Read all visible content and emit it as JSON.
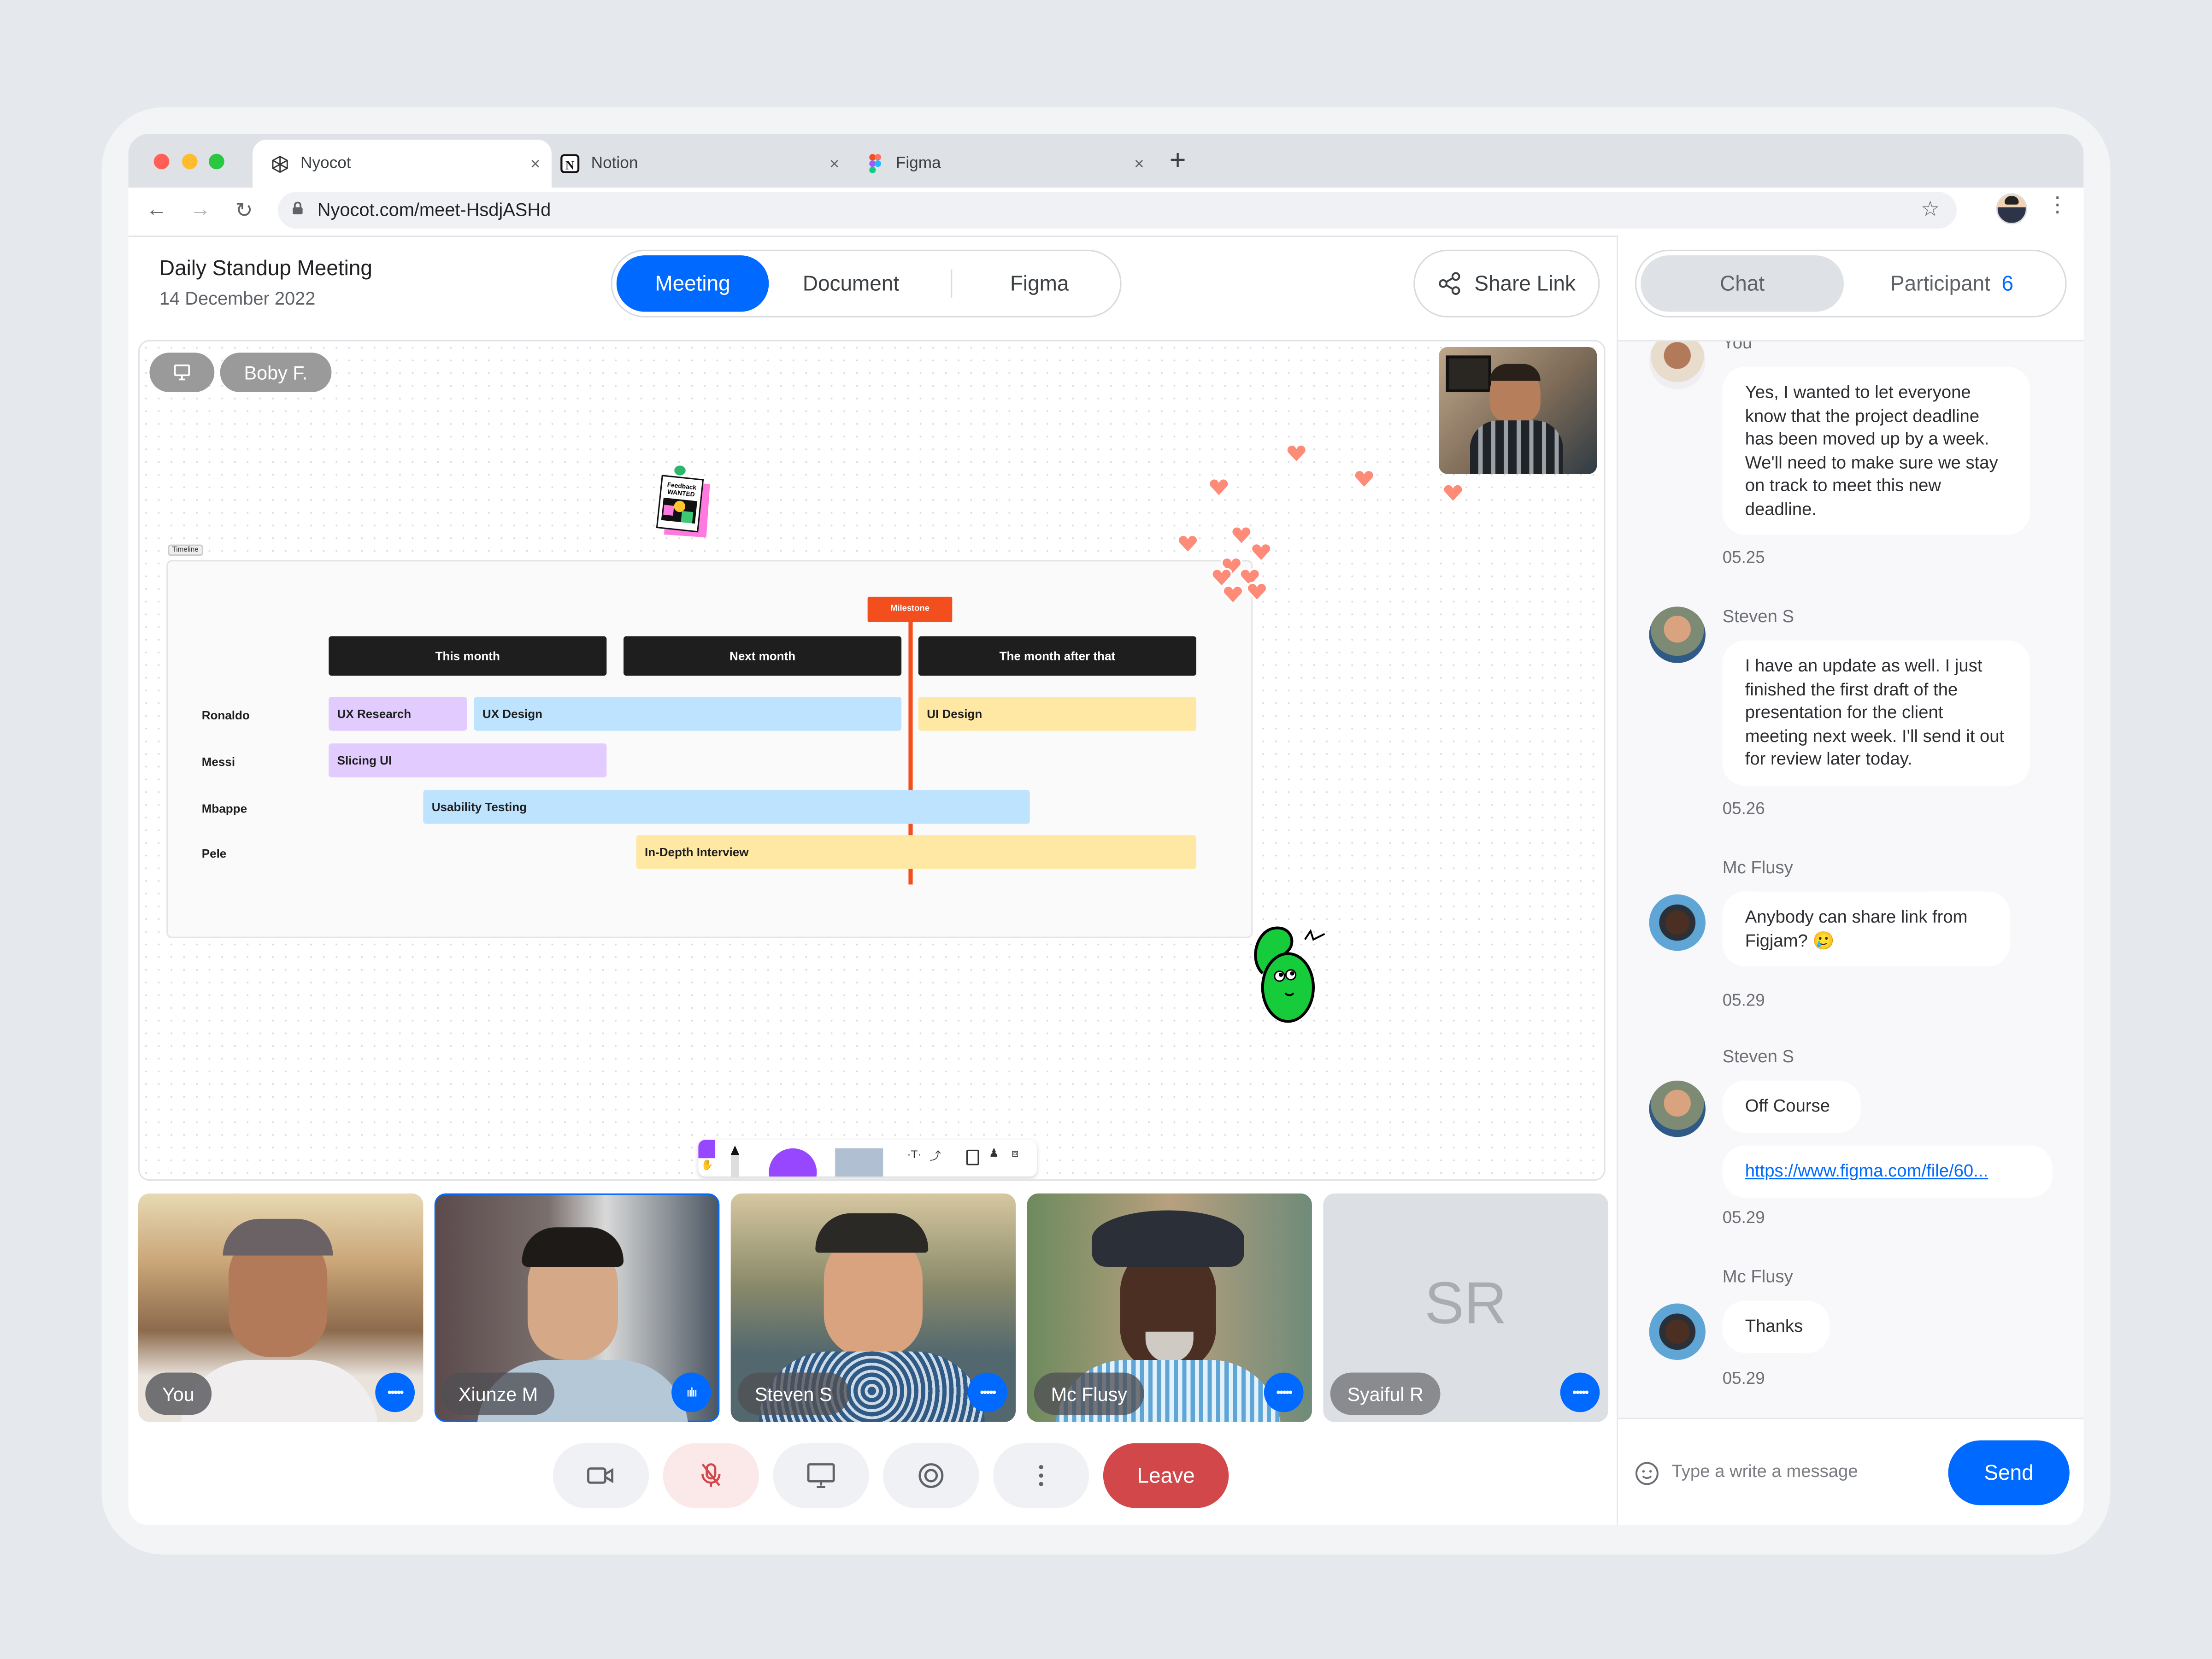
{
  "browser": {
    "tabs": [
      {
        "title": "Nyocot",
        "icon": "nyocot-logo-icon",
        "active": true
      },
      {
        "title": "Notion",
        "icon": "notion-logo-icon",
        "active": false
      },
      {
        "title": "Figma",
        "icon": "figma-logo-icon",
        "active": false
      }
    ],
    "new_tab_label": "+",
    "close_label": "×",
    "url": "Nyocot.com/meet-HsdjASHd"
  },
  "header": {
    "title": "Daily Standup Meeting",
    "date": "14 December 2022",
    "view_tabs": [
      "Meeting",
      "Document",
      "Figma"
    ],
    "active_view": "Meeting",
    "share_label": "Share Link"
  },
  "canvas": {
    "presenter_label": "Boby F.",
    "timeline_label": "Timeline",
    "sticker_text": [
      "Feedback",
      "WANTED"
    ],
    "timeline": {
      "columns": [
        "This month",
        "Next month",
        "The month after that"
      ],
      "milestone": "Milestone",
      "rows": [
        {
          "name": "Ronaldo",
          "tasks": [
            {
              "label": "UX Research",
              "color": "purple"
            },
            {
              "label": "UX Design",
              "color": "blue"
            },
            {
              "label": "UI Design",
              "color": "yellow"
            }
          ]
        },
        {
          "name": "Messi",
          "tasks": [
            {
              "label": "Slicing UI",
              "color": "purple"
            }
          ]
        },
        {
          "name": "Mbappe",
          "tasks": [
            {
              "label": "Usability Testing",
              "color": "blue"
            }
          ]
        },
        {
          "name": "Pele",
          "tasks": [
            {
              "label": "In-Depth Interview",
              "color": "yellow"
            }
          ]
        }
      ]
    }
  },
  "participants": [
    {
      "name": "You",
      "status": "more",
      "speaking": false
    },
    {
      "name": "Xiunze M",
      "status": "speaking",
      "speaking": true
    },
    {
      "name": "Steven S",
      "status": "more",
      "speaking": false
    },
    {
      "name": "Mc Flusy",
      "status": "more",
      "speaking": false
    },
    {
      "name": "Syaiful R",
      "initials": "SR",
      "status": "more",
      "speaking": false
    }
  ],
  "controls": {
    "camera": "camera-icon",
    "mic": "mic-off-icon",
    "screen": "screen-share-icon",
    "record": "record-icon",
    "more": "more-vertical-icon",
    "leave_label": "Leave"
  },
  "chat": {
    "tabs": {
      "chat": "Chat",
      "participant": "Participant",
      "participant_count": "6"
    },
    "messages": [
      {
        "sender": "You",
        "bubbles": [
          "Yes, I wanted to let everyone know that the project deadline has been moved up by a week. We'll need to make sure we stay on track to meet this new deadline."
        ],
        "time": "05.25"
      },
      {
        "sender": "Steven S",
        "bubbles": [
          "I have an update as well. I just finished the first draft of the presentation for the client meeting next week. I'll send it out for review later today."
        ],
        "time": "05.26"
      },
      {
        "sender": "Mc Flusy",
        "bubbles": [
          "Anybody can share link from Figjam? 🥲"
        ],
        "time": "05.29"
      },
      {
        "sender": "Steven S",
        "bubbles": [
          "Off Course",
          "https://www.figma.com/file/60..."
        ],
        "time": "05.29"
      },
      {
        "sender": "Mc Flusy",
        "bubbles": [
          "Thanks"
        ],
        "time": "05.29"
      }
    ],
    "input_placeholder": "Type a write a message",
    "send_label": "Send"
  },
  "colors": {
    "accent": "#0069ff",
    "danger": "#d2474a",
    "milestone": "#f24e1e",
    "task_purple": "#e2ccff",
    "task_blue": "#bde3ff",
    "task_yellow": "#ffe8a3"
  }
}
